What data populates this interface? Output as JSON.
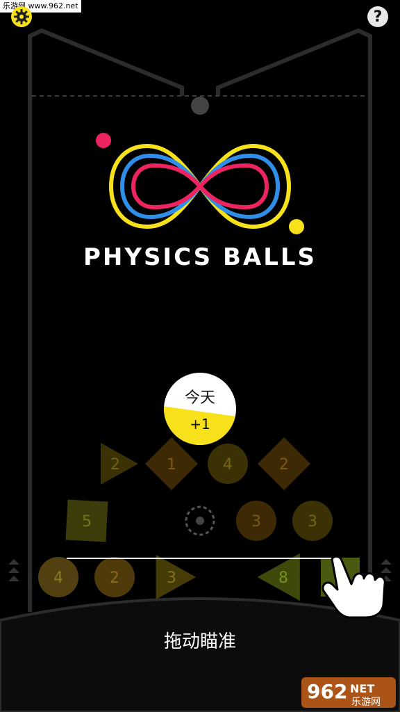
{
  "watermark_top": "乐游网 www.962.net",
  "icons": {
    "settings": "gear-icon",
    "help": "question-icon"
  },
  "help_glyph": "?",
  "logo": {
    "title": "PHYSICS BALLS",
    "colors": {
      "yellow": "#f7e11a",
      "blue": "#2f8fe8",
      "pink": "#ee2460"
    }
  },
  "daily_reward": {
    "day_label": "今天",
    "reward": "+1"
  },
  "blocks": [
    {
      "shape": "triangle",
      "value": "2",
      "color": "#3a3205",
      "text_color": "#736414"
    },
    {
      "shape": "diamond",
      "value": "1",
      "color": "#3d2a05",
      "text_color": "#7a5a14"
    },
    {
      "shape": "circle",
      "value": "4",
      "color": "#3a3205",
      "text_color": "#736414"
    },
    {
      "shape": "diamond",
      "value": "2",
      "color": "#3d2a05",
      "text_color": "#7a5a14"
    },
    {
      "shape": "square",
      "value": "5",
      "color": "#3c3c0a",
      "text_color": "#767616"
    },
    {
      "shape": "circle",
      "value": "3",
      "color": "#3d2a05",
      "text_color": "#7a5a14"
    },
    {
      "shape": "circle",
      "value": "3",
      "color": "#3a3205",
      "text_color": "#736414"
    },
    {
      "shape": "circle",
      "value": "4",
      "color": "#524010",
      "text_color": "#8a7a20"
    },
    {
      "shape": "circle",
      "value": "2",
      "color": "#4f3a0c",
      "text_color": "#8a6a18"
    },
    {
      "shape": "triangle",
      "value": "3",
      "color": "#453c08",
      "text_color": "#857419"
    },
    {
      "shape": "triangle",
      "value": "8",
      "color": "#3d4a0c",
      "text_color": "#7a8e1c"
    },
    {
      "shape": "square",
      "value": "",
      "color": "#4a5a10",
      "text_color": "#8aa020"
    }
  ],
  "hint": "拖动瞄准",
  "watermark_bottom": {
    "brand": "962",
    "suffix": "NET",
    "site": "乐游网"
  }
}
